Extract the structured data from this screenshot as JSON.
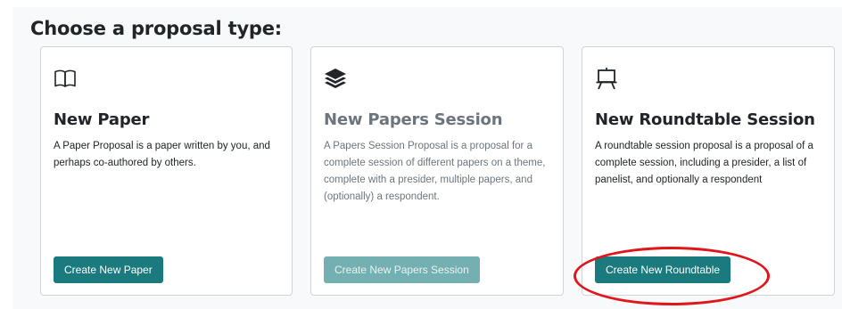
{
  "page": {
    "heading": "Choose a proposal type:"
  },
  "cards": [
    {
      "icon": "open-book-icon",
      "title": "New Paper",
      "description": "A Paper Proposal is a paper written by you, and perhaps co-authored by others.",
      "button_label": "Create New Paper",
      "enabled": true
    },
    {
      "icon": "layers-icon",
      "title": "New Papers Session",
      "description": "A Papers Session Proposal is a proposal for a complete session of different papers on a theme, complete with a presider, multiple papers, and (optionally) a respondent.",
      "button_label": "Create New Papers Session",
      "enabled": false
    },
    {
      "icon": "easel-icon",
      "title": "New Roundtable Session",
      "description": "A roundtable session proposal is a proposal of a complete session, including a presider, a list of panelist, and optionally a respondent",
      "button_label": "Create New Roundtable",
      "enabled": true
    }
  ],
  "colors": {
    "button": "#1b7a7d",
    "button_disabled": "#74b0b1",
    "highlight": "#e1161b"
  }
}
